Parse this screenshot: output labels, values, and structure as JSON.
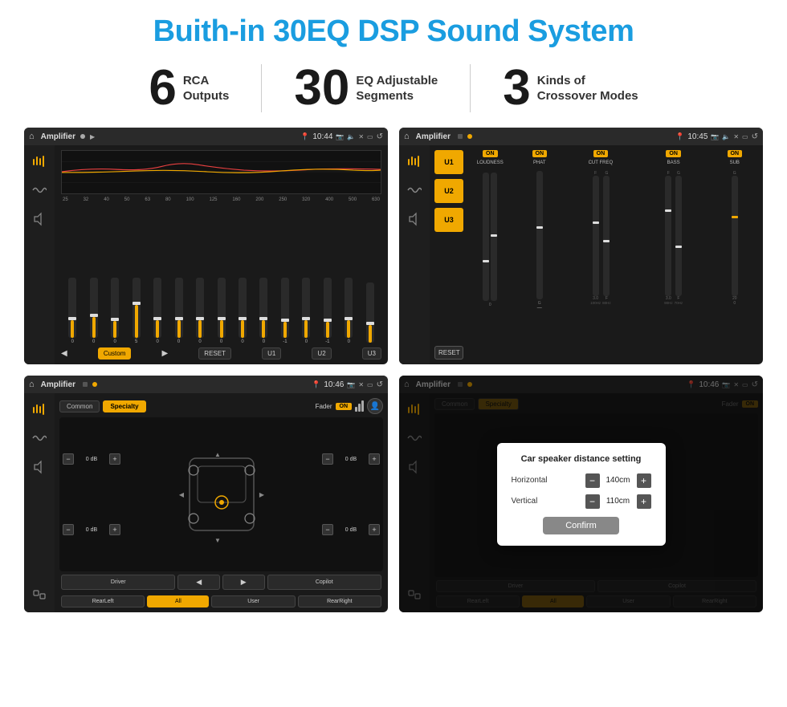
{
  "page": {
    "title": "Buith-in 30EQ DSP Sound System"
  },
  "stats": [
    {
      "number": "6",
      "line1": "RCA",
      "line2": "Outputs"
    },
    {
      "number": "30",
      "line1": "EQ Adjustable",
      "line2": "Segments"
    },
    {
      "number": "3",
      "line1": "Kinds of",
      "line2": "Crossover Modes"
    }
  ],
  "screens": {
    "eq": {
      "time": "10:44",
      "title": "Amplifier",
      "freqs": [
        "25",
        "32",
        "40",
        "50",
        "63",
        "80",
        "100",
        "125",
        "160",
        "200",
        "250",
        "320",
        "400",
        "500",
        "630"
      ],
      "values": [
        "0",
        "0",
        "0",
        "5",
        "0",
        "0",
        "0",
        "0",
        "0",
        "0",
        "-1",
        "0",
        "-1",
        "",
        ""
      ],
      "buttons": [
        "Custom",
        "RESET",
        "U1",
        "U2",
        "U3"
      ]
    },
    "crossover": {
      "time": "10:45",
      "title": "Amplifier",
      "channels": [
        "LOUDNESS",
        "PHAT",
        "CUT FREQ",
        "BASS",
        "SUB"
      ],
      "buttons": [
        "U1",
        "U2",
        "U3"
      ],
      "reset": "RESET"
    },
    "specialty": {
      "time": "10:46",
      "title": "Amplifier",
      "tabs": [
        "Common",
        "Specialty"
      ],
      "fader": "Fader",
      "faderOn": "ON",
      "db_values": [
        "0 dB",
        "0 dB",
        "0 dB",
        "0 dB"
      ],
      "positions": [
        "Driver",
        "Copilot",
        "RearLeft",
        "RearRight"
      ],
      "all_btn": "All",
      "user_btn": "User"
    },
    "dialog": {
      "time": "10:46",
      "title": "Amplifier",
      "dialog_title": "Car speaker distance setting",
      "horizontal_label": "Horizontal",
      "horizontal_value": "140cm",
      "vertical_label": "Vertical",
      "vertical_value": "110cm",
      "confirm": "Confirm",
      "driver": "Driver",
      "copilot": "Copilot",
      "rearLeft": "RearLeft",
      "all": "All",
      "user": "User",
      "rearRight": "RearRight"
    }
  }
}
